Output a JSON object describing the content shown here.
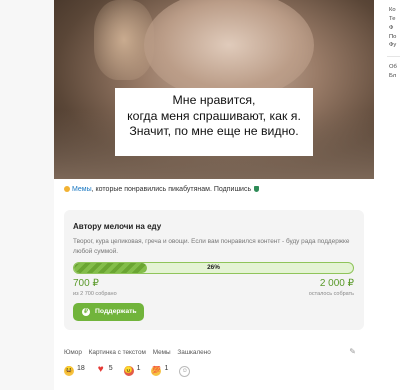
{
  "post": {
    "image_caption_lines": [
      "Мне нравится,",
      "когда меня спрашивают, как я.",
      "Значит, по мне еще не видно."
    ],
    "community": {
      "name": "Мемы",
      "text": ", которые понравились пикабутянам. Подпишись"
    }
  },
  "donation": {
    "title": "Автору мелочи на еду",
    "description": "Творог, кура целиковая, греча и овощи. Если вам понравился контент - буду рада поддержке любой суммой.",
    "percent_label": "26%",
    "progress_fraction": 0.26,
    "raised_amount": "700 ₽",
    "raised_caption": "из 2 700 собрано",
    "goal_amount": "2 000 ₽",
    "goal_caption": "осталось собрать",
    "button_label": "Поддержать",
    "accent_color": "#71b43b"
  },
  "tags": [
    "Юмор",
    "Картинка с текстом",
    "Мемы",
    "Зашкалено"
  ],
  "reactions": [
    {
      "icon": "laughing-face-icon",
      "count": "18"
    },
    {
      "icon": "heart-icon",
      "count": "5"
    },
    {
      "icon": "angry-face-icon",
      "count": "1"
    },
    {
      "icon": "hundred-icon",
      "count": "1"
    }
  ],
  "sidebar": {
    "items": [
      "Ко",
      "Те",
      "Ф",
      "По",
      "Фу",
      "Об",
      "Бл"
    ]
  }
}
